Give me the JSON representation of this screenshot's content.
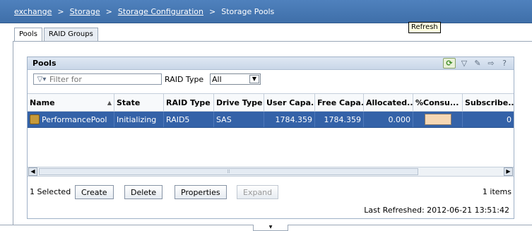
{
  "breadcrumb": {
    "items": [
      "exchange",
      "Storage",
      "Storage Configuration",
      "Storage Pools"
    ],
    "separator": ">"
  },
  "tabs": [
    "Pools",
    "RAID Groups"
  ],
  "panel": {
    "title": "Pools",
    "tooltip": "Refresh",
    "filter_placeholder": "Filter for",
    "raid_type_label": "RAID Type",
    "raid_type_value": "All"
  },
  "table": {
    "columns": [
      "Name",
      "State",
      "RAID Type",
      "Drive Type",
      "User Capa...",
      "Free Capa...",
      "Allocated...",
      "%Consu...",
      "Subscribe..."
    ],
    "rows": [
      {
        "name": "PerformancePool",
        "state": "Initializing",
        "raid_type": "RAID5",
        "drive_type": "SAS",
        "user_capacity": "1784.359",
        "free_capacity": "1784.359",
        "allocated": "0.000",
        "subscribed": "0"
      }
    ]
  },
  "footer": {
    "selected_text": "1 Selected",
    "buttons": [
      "Create",
      "Delete",
      "Properties",
      "Expand"
    ],
    "items_count": "1 items",
    "last_refreshed": "Last Refreshed: 2012-06-21 13:51:42"
  },
  "colors": {
    "breadcrumb_bg": "#4f81bd",
    "selection": "#3462a8",
    "panel_header": "#c9d7e8"
  }
}
